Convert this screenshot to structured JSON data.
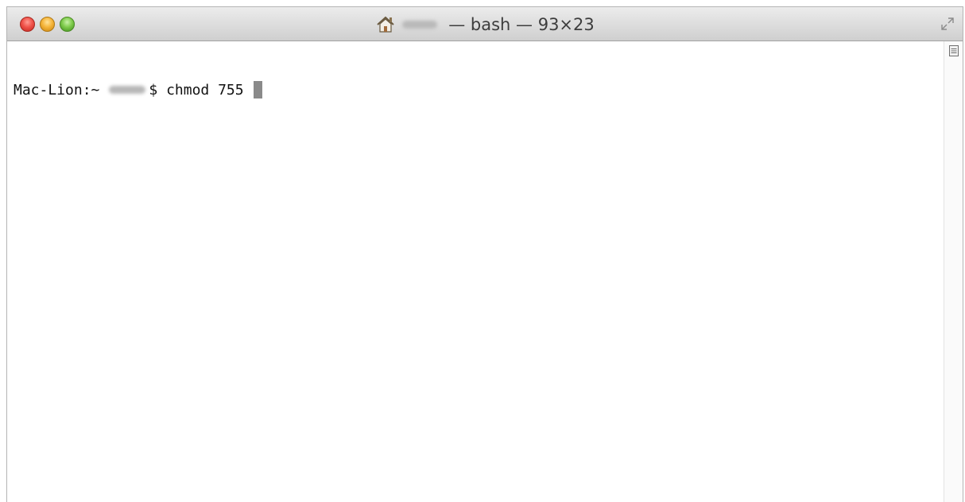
{
  "window": {
    "title_suffix": "— bash — 93×23",
    "icons": {
      "home": "home-icon",
      "resize": "fullscreen-arrows-icon",
      "split": "split-pane-icon"
    }
  },
  "terminal": {
    "host_prompt": "Mac-Lion:~",
    "prompt_symbol": "$",
    "command": "chmod 755"
  },
  "colors": {
    "close": "#f0534a",
    "minimize": "#f5b53b",
    "zoom": "#7fcb4c"
  }
}
